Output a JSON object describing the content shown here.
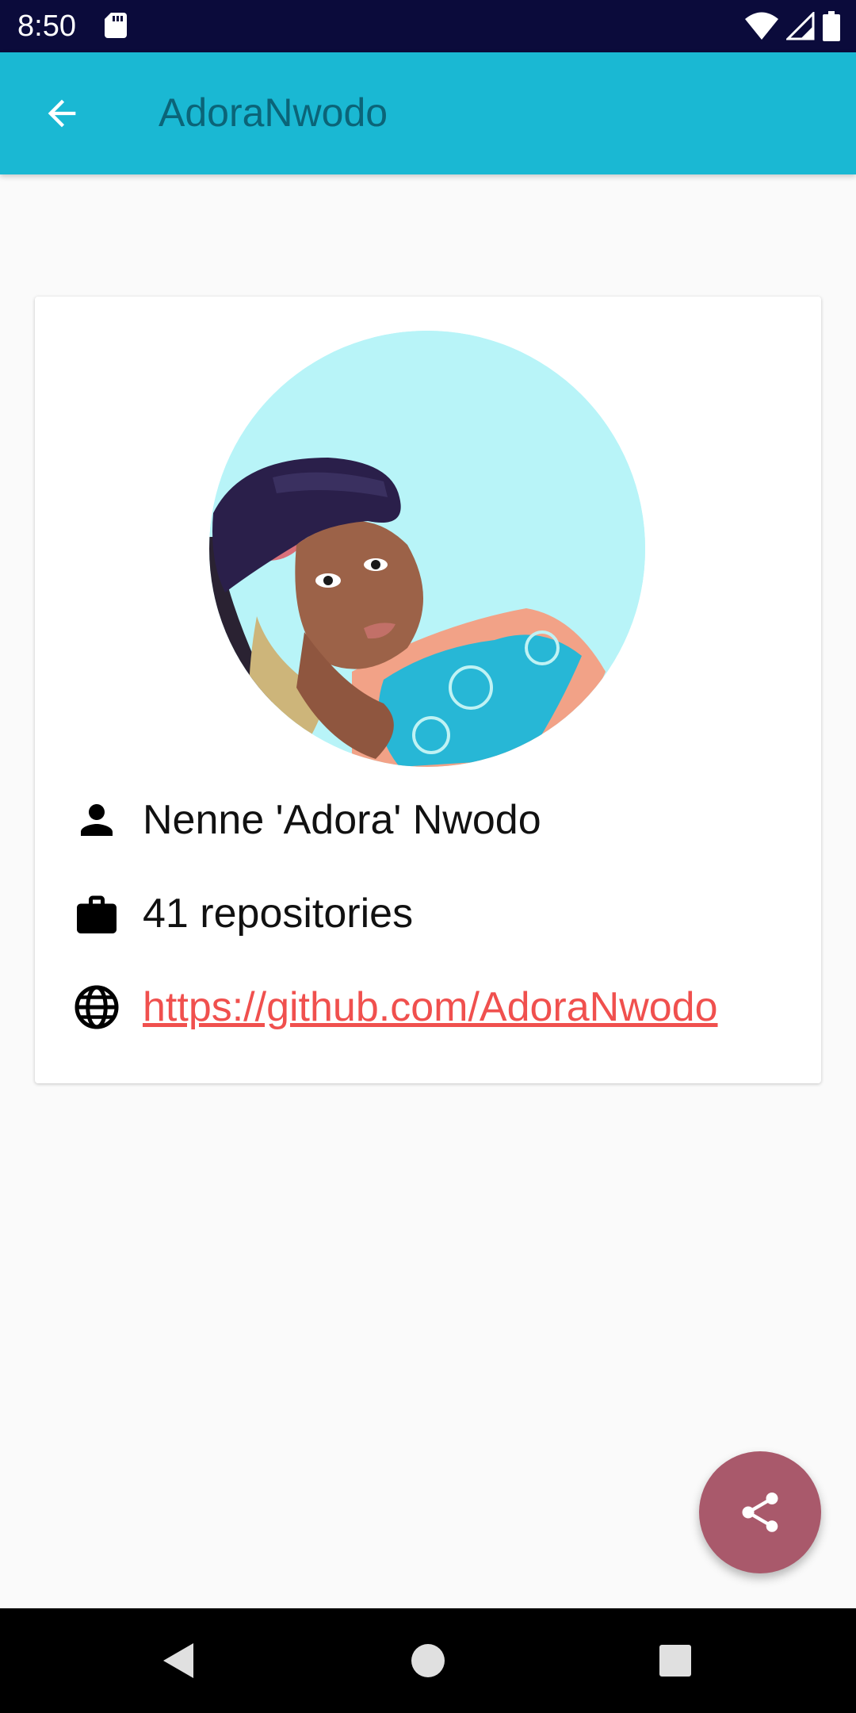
{
  "status_bar": {
    "time": "8:50",
    "icons": [
      "sd-card-icon",
      "wifi-icon",
      "signal-icon",
      "battery-icon"
    ]
  },
  "app_bar": {
    "title": "AdoraNwodo",
    "back_icon": "arrow-back-icon"
  },
  "profile": {
    "avatar_icon": "avatar-illustration",
    "name": "Nenne 'Adora' Nwodo",
    "repositories": "41 repositories",
    "url": "https://github.com/AdoraNwodo"
  },
  "fab": {
    "icon": "share-icon"
  },
  "nav_bar": {
    "icons": [
      "back-triangle-icon",
      "home-circle-icon",
      "recents-square-icon"
    ]
  },
  "colors": {
    "status_bar": "#0b0b3b",
    "app_bar": "#1ab8d3",
    "title": "#0b6478",
    "link": "#f0504e",
    "fab": "#a9596b",
    "background": "#fafafa"
  }
}
